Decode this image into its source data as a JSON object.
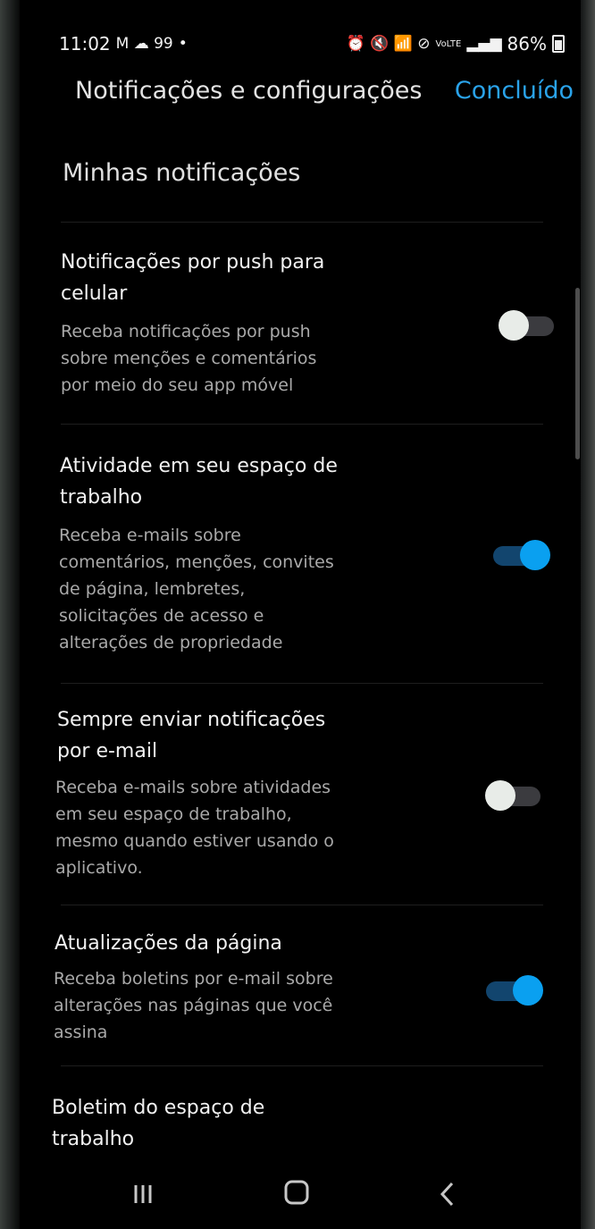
{
  "status_bar": {
    "time": "11:02",
    "notif_icons": "M ☁ 99",
    "right_icons": "⏰ 🔇 📶 ⊘",
    "network_label": "VoLTE",
    "battery": "86%"
  },
  "header": {
    "title": "Notificações e configurações",
    "done_label": "Concluído"
  },
  "section": {
    "title": "Minhas notificações"
  },
  "settings": [
    {
      "title_lines": [
        "Notificações por push para",
        "celular"
      ],
      "desc_lines": [
        "Receba notificações por push",
        "sobre menções e comentários",
        "por meio do seu app móvel"
      ],
      "enabled": false
    },
    {
      "title_lines": [
        "Atividade em seu espaço de",
        "trabalho"
      ],
      "desc_lines": [
        "Receba e-mails sobre",
        "comentários, menções, convites",
        "de página, lembretes,",
        "solicitações de acesso e",
        "alterações de propriedade"
      ],
      "enabled": true
    },
    {
      "title_lines": [
        "Sempre enviar notificações",
        "por e-mail"
      ],
      "desc_lines": [
        "Receba e-mails sobre atividades",
        "em seu espaço de trabalho,",
        "mesmo quando estiver usando o",
        "aplicativo."
      ],
      "enabled": false
    },
    {
      "title_lines": [
        "Atualizações da página"
      ],
      "desc_lines": [
        "Receba boletins por e-mail sobre",
        "alterações nas páginas que você",
        "assina"
      ],
      "enabled": true
    },
    {
      "title_lines": [
        "Boletim do espaço de",
        "trabalho"
      ],
      "desc_lines": [],
      "enabled": null
    }
  ],
  "colors": {
    "accent": "#2aa3ea",
    "toggle_on": "#0aa0f0",
    "toggle_on_track": "#12456e",
    "toggle_off_knob": "#e8ece8",
    "toggle_off_track": "#3b3b3f"
  },
  "nav": {
    "recents_icon": "recents-icon",
    "home_icon": "home-icon",
    "back_icon": "back-icon"
  }
}
